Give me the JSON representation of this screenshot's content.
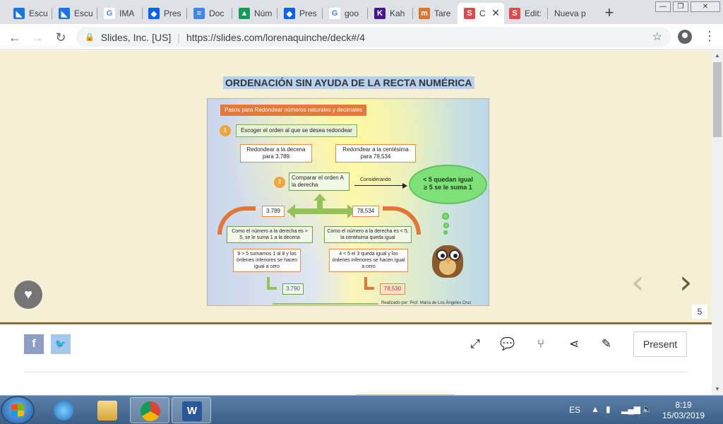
{
  "browser": {
    "tabs": [
      {
        "label": "Escu",
        "icon": "classroom-icon",
        "color": "#1a73e8"
      },
      {
        "label": "Escu",
        "icon": "classroom-icon",
        "color": "#1a73e8"
      },
      {
        "label": "IMA",
        "icon": "google-icon",
        "color": "#4285f4"
      },
      {
        "label": "Pres",
        "icon": "dropbox-icon",
        "color": "#0061fe"
      },
      {
        "label": "Doc",
        "icon": "docs-icon",
        "color": "#4285f4"
      },
      {
        "label": "Núm",
        "icon": "drive-icon",
        "color": "#0f9d58"
      },
      {
        "label": "Pres",
        "icon": "dropbox-icon",
        "color": "#0061fe"
      },
      {
        "label": "goo",
        "icon": "google-icon",
        "color": "#4285f4"
      },
      {
        "label": "Kah",
        "icon": "kahoot-icon",
        "color": "#46178f"
      },
      {
        "label": "Tare",
        "icon": "tareas-icon",
        "color": "#e0722b"
      },
      {
        "label": "C",
        "icon": "slides-icon",
        "color": "#e04a4a",
        "active": true
      },
      {
        "label": "Edit:",
        "icon": "slides-icon",
        "color": "#e04a4a"
      },
      {
        "label": "Nueva p",
        "icon": "",
        "color": ""
      }
    ],
    "url_site": "Slides, Inc. [US]",
    "url": "https://slides.com/lorenaquinche/deck#/4"
  },
  "slide": {
    "title": "ORDENACIÓN SIN AYUDA DE LA RECTA NUMÉRICA",
    "number": "5",
    "infographic": {
      "header": "Pasos para  Redondear números naturales y decimales",
      "step1": "Escoger el orden al que se desea redondear",
      "box_decena": "Redondear a la decena para 3.789",
      "box_centesima": "Redondear a la centésima para 78,534",
      "step2": "Comparar el orden A la derecha",
      "considerando": "Considerando",
      "cloud_line1": "< 5 quedan igual",
      "cloud_line2": "≥ 5  se le suma 1",
      "val_left": "3.789",
      "val_right": "78,534",
      "cond_left": "Como el número a la derecha es  > 5, se le suma 1 a la decena",
      "cond_right": "Como el número a la derecha es < 5, la centésima queda igual",
      "expl_left": "9 > 5 sumamos 1 al 8 y los órdenes inferiores se hacen igual a cero",
      "expl_right": "4 < 5 el 3 queda igual y los órdenes inferiores se hacen igual a cero",
      "result_left": "3.790",
      "result_right": "78,530",
      "credit": "Realizado por: Prof. María de Los Ángeles Cruz"
    }
  },
  "toolbar": {
    "present_label": "Present"
  },
  "taskbar": {
    "language": "ES",
    "time": "8:19",
    "date": "15/03/2019"
  }
}
